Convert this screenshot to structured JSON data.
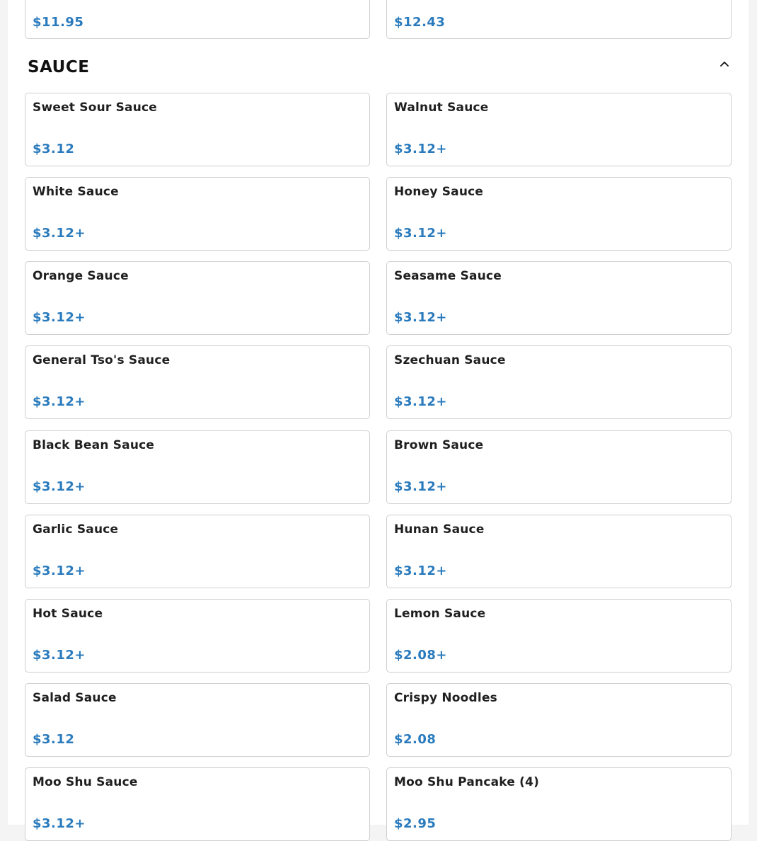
{
  "previous_section": {
    "items": [
      {
        "price": "$11.95"
      },
      {
        "price": "$12.43"
      }
    ]
  },
  "section": {
    "title": "SAUCE",
    "collapse_icon": "chevron-up-icon",
    "items": [
      {
        "name": "Sweet Sour Sauce",
        "price": "$3.12"
      },
      {
        "name": "Walnut Sauce",
        "price": "$3.12+"
      },
      {
        "name": "White Sauce",
        "price": "$3.12+"
      },
      {
        "name": "Honey Sauce",
        "price": "$3.12+"
      },
      {
        "name": "Orange Sauce",
        "price": "$3.12+"
      },
      {
        "name": "Seasame Sauce",
        "price": "$3.12+"
      },
      {
        "name": "General Tso's Sauce",
        "price": "$3.12+"
      },
      {
        "name": "Szechuan Sauce",
        "price": "$3.12+"
      },
      {
        "name": "Black Bean Sauce",
        "price": "$3.12+"
      },
      {
        "name": "Brown Sauce",
        "price": "$3.12+"
      },
      {
        "name": "Garlic Sauce",
        "price": "$3.12+"
      },
      {
        "name": "Hunan Sauce",
        "price": "$3.12+"
      },
      {
        "name": "Hot Sauce",
        "price": "$3.12+"
      },
      {
        "name": "Lemon Sauce",
        "price": "$2.08+"
      },
      {
        "name": "Salad Sauce",
        "price": "$3.12"
      },
      {
        "name": "Crispy Noodles",
        "price": "$2.08"
      },
      {
        "name": "Moo Shu Sauce",
        "price": "$3.12+"
      },
      {
        "name": "Moo Shu Pancake (4)",
        "price": "$2.95"
      }
    ]
  },
  "colors": {
    "price": "#2a7bbd",
    "name": "#1f1f1f",
    "border": "#cfcfcf"
  }
}
